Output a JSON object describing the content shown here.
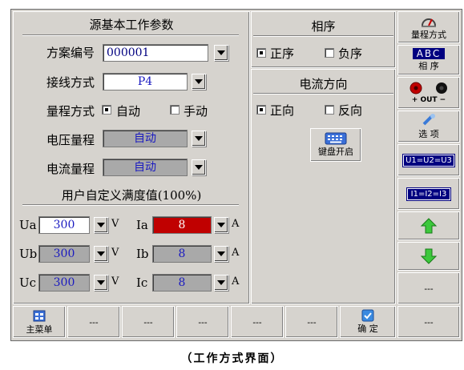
{
  "main": {
    "title": "源基本工作参数",
    "scheme_label": "方案编号",
    "scheme_value": "000001",
    "wiring_label": "接线方式",
    "wiring_value": "P4",
    "range_mode_label": "量程方式",
    "range_auto": "自动",
    "range_manual": "手动",
    "voltage_range_label": "电压量程",
    "voltage_range_value": "自动",
    "current_range_label": "电流量程",
    "current_range_value": "自动",
    "custom_title": "用户自定义满度值(100%)",
    "ua_label": "Ua",
    "ua_value": "300",
    "ua_unit": "V",
    "ub_label": "Ub",
    "ub_value": "300",
    "ub_unit": "V",
    "uc_label": "Uc",
    "uc_value": "300",
    "uc_unit": "V",
    "ia_label": "Ia",
    "ia_value": "8",
    "ia_unit": "A",
    "ib_label": "Ib",
    "ib_value": "8",
    "ib_unit": "A",
    "ic_label": "Ic",
    "ic_value": "8",
    "ic_unit": "A"
  },
  "phase": {
    "title": "相序",
    "positive": "正序",
    "negative": "负序"
  },
  "direction": {
    "title": "电流方向",
    "forward": "正向",
    "reverse": "反向",
    "keyboard_label": "键盘开启"
  },
  "sidebar": {
    "range_mode": "量程方式",
    "phase_abc": "ABC",
    "phase_label": "相 序",
    "out_label": "OUT",
    "options": "选 项",
    "u_equal": "U1=U2=U3",
    "i_equal": "I1=I2=I3",
    "blank": "---"
  },
  "bottom": {
    "main_menu": "主菜单",
    "blank": "---",
    "confirm": "确 定"
  },
  "caption": "（工作方式界面）"
}
